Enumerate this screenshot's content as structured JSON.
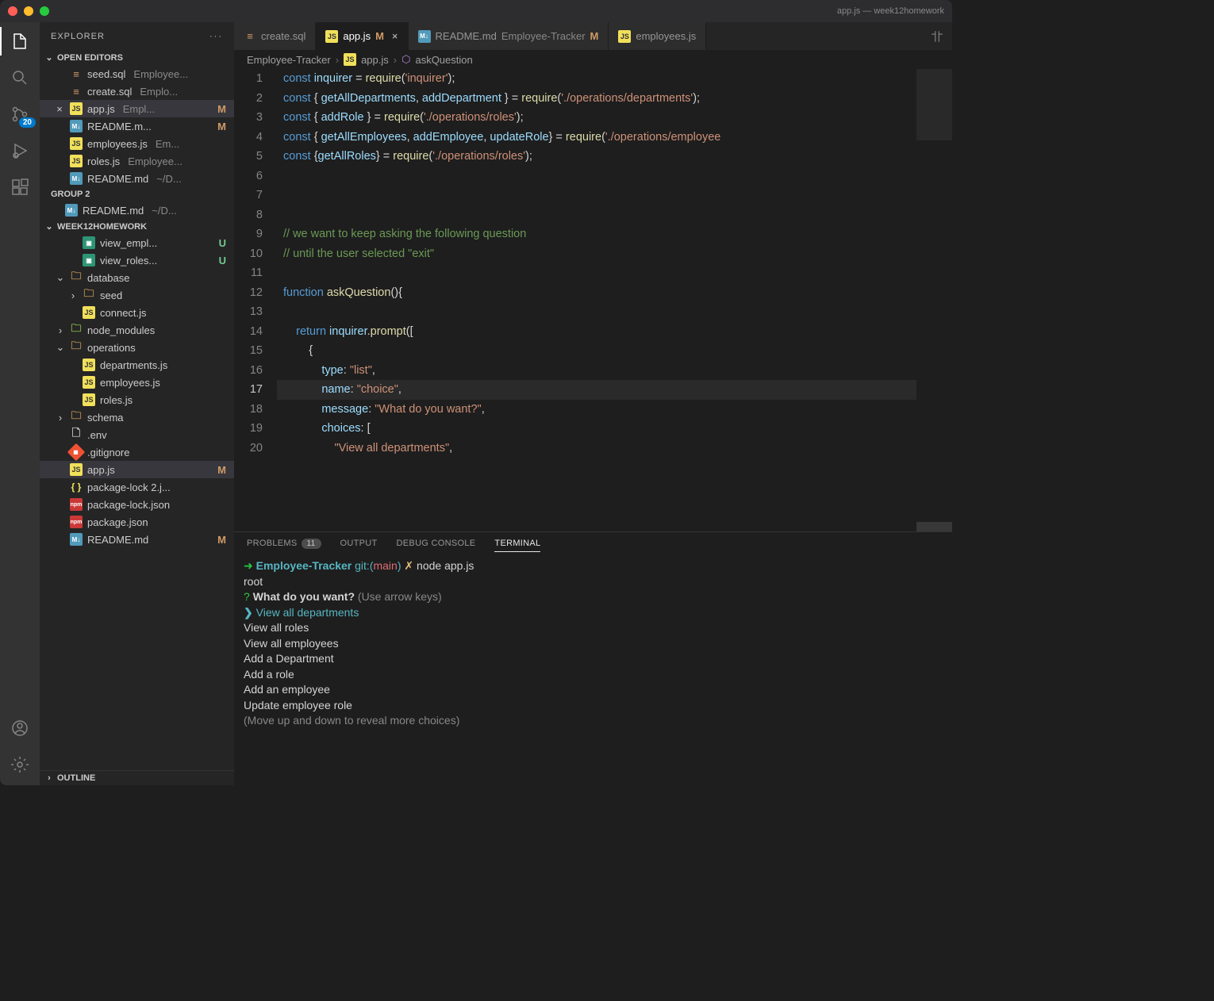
{
  "titlebar": {
    "title": "app.js — week12homework"
  },
  "activity": {
    "scm_badge": "20"
  },
  "sidebar": {
    "title": "EXPLORER",
    "sections": {
      "openEditors": "OPEN EDITORS",
      "group2": "GROUP 2",
      "workspace": "WEEK12HOMEWORK",
      "outline": "OUTLINE"
    },
    "openEditors": [
      {
        "icon": "db",
        "name": "seed.sql",
        "sub": "Employee..."
      },
      {
        "icon": "db",
        "name": "create.sql",
        "sub": "Emplo..."
      },
      {
        "icon": "js",
        "name": "app.js",
        "sub": "Empl...",
        "m": "M",
        "close": true,
        "sel": true
      },
      {
        "icon": "md",
        "name": "README.m...",
        "sub": "",
        "m": "M"
      },
      {
        "icon": "js",
        "name": "employees.js",
        "sub": "Em..."
      },
      {
        "icon": "js",
        "name": "roles.js",
        "sub": "Employee..."
      },
      {
        "icon": "md",
        "name": "README.md",
        "sub": "~/D..."
      }
    ],
    "group2": [
      {
        "icon": "md",
        "name": "README.md",
        "sub": "~/D..."
      }
    ],
    "files": [
      {
        "type": "item",
        "indent": 2,
        "icon": "img",
        "name": "view_empl...",
        "u": "U"
      },
      {
        "type": "item",
        "indent": 2,
        "icon": "img",
        "name": "view_roles...",
        "u": "U"
      },
      {
        "type": "folder",
        "indent": 1,
        "open": true,
        "icon": "folder",
        "name": "database"
      },
      {
        "type": "folder",
        "indent": 2,
        "open": false,
        "icon": "folder",
        "name": "seed"
      },
      {
        "type": "item",
        "indent": 2,
        "icon": "js",
        "name": "connect.js"
      },
      {
        "type": "folder",
        "indent": 1,
        "open": false,
        "icon": "folder green",
        "name": "node_modules"
      },
      {
        "type": "folder",
        "indent": 1,
        "open": true,
        "icon": "folder",
        "name": "operations"
      },
      {
        "type": "item",
        "indent": 2,
        "icon": "js",
        "name": "departments.js"
      },
      {
        "type": "item",
        "indent": 2,
        "icon": "js",
        "name": "employees.js"
      },
      {
        "type": "item",
        "indent": 2,
        "icon": "js",
        "name": "roles.js"
      },
      {
        "type": "folder",
        "indent": 1,
        "open": false,
        "icon": "folder",
        "name": "schema"
      },
      {
        "type": "item",
        "indent": 1,
        "icon": "env",
        "name": ".env"
      },
      {
        "type": "item",
        "indent": 1,
        "icon": "git",
        "name": ".gitignore"
      },
      {
        "type": "item",
        "indent": 1,
        "icon": "js",
        "name": "app.js",
        "m": "M",
        "sel": true
      },
      {
        "type": "item",
        "indent": 1,
        "icon": "json",
        "name": "package-lock 2.j..."
      },
      {
        "type": "item",
        "indent": 1,
        "icon": "npm",
        "name": "package-lock.json"
      },
      {
        "type": "item",
        "indent": 1,
        "icon": "npm",
        "name": "package.json"
      },
      {
        "type": "item",
        "indent": 1,
        "icon": "md",
        "name": "README.md",
        "m": "M"
      }
    ]
  },
  "tabs": [
    {
      "icon": "db",
      "label": "create.sql"
    },
    {
      "icon": "js",
      "label": "app.js",
      "m": "M",
      "close": true,
      "active": true
    },
    {
      "icon": "md",
      "label": "README.md",
      "sub": "Employee-Tracker",
      "m": "M"
    },
    {
      "icon": "js",
      "label": "employees.js"
    }
  ],
  "breadcrumb": {
    "p1": "Employee-Tracker",
    "p2": "app.js",
    "p3": "askQuestion"
  },
  "code": {
    "lines": [
      "1",
      "2",
      "3",
      "4",
      "5",
      "6",
      "7",
      "8",
      "9",
      "10",
      "11",
      "12",
      "13",
      "14",
      "15",
      "16",
      "17",
      "18",
      "19",
      "20"
    ],
    "current": "17",
    "l1": {
      "a": "const",
      "b": "inquirer",
      "c": "require",
      "d": "'inquirer'"
    },
    "l2": {
      "a": "const",
      "b": "getAllDepartments",
      "c": "addDepartment",
      "d": "require",
      "e": "'./operations/departments'"
    },
    "l3": {
      "a": "const",
      "b": "addRole",
      "c": "require",
      "d": "'./operations/roles'"
    },
    "l4": {
      "a": "const",
      "b": "getAllEmployees",
      "c": "addEmployee",
      "d": "updateRole",
      "e": "require",
      "f": "'./operations/employee"
    },
    "l5": {
      "a": "const",
      "b": "getAllRoles",
      "c": "require",
      "d": "'./operations/roles'"
    },
    "l9": "// we want to keep asking the following question",
    "l10": "// until the user selected \"exit\"",
    "l12": {
      "a": "function",
      "b": "askQuestion"
    },
    "l14": {
      "a": "return",
      "b": "inquirer",
      "c": "prompt"
    },
    "l16": {
      "a": "type",
      "b": "\"list\""
    },
    "l17": {
      "a": "name",
      "b": "\"choice\""
    },
    "l18": {
      "a": "message",
      "b": "\"What do you want?\""
    },
    "l19": {
      "a": "choices"
    },
    "l20": {
      "a": "\"View all departments\""
    }
  },
  "panel": {
    "tabs": {
      "problems": "PROBLEMS",
      "pcount": "11",
      "output": "OUTPUT",
      "debug": "DEBUG CONSOLE",
      "terminal": "TERMINAL"
    }
  },
  "terminal": {
    "arrow": "➜",
    "path": "Employee-Tracker",
    "git": "git:(",
    "branch": "main",
    "gitend": ")",
    "x": "✗",
    "cmd": "node app.js",
    "root": "root",
    "q": "?",
    "prompt": "What do you want?",
    "hint": "(Use arrow keys)",
    "selArrow": "❯",
    "opt1": "View all departments",
    "opt2": "View all roles",
    "opt3": "View all employees",
    "opt4": "Add a Department",
    "opt5": "Add a role",
    "opt6": "Add an employee",
    "opt7": "Update employee role",
    "move": "(Move up and down to reveal more choices)"
  }
}
